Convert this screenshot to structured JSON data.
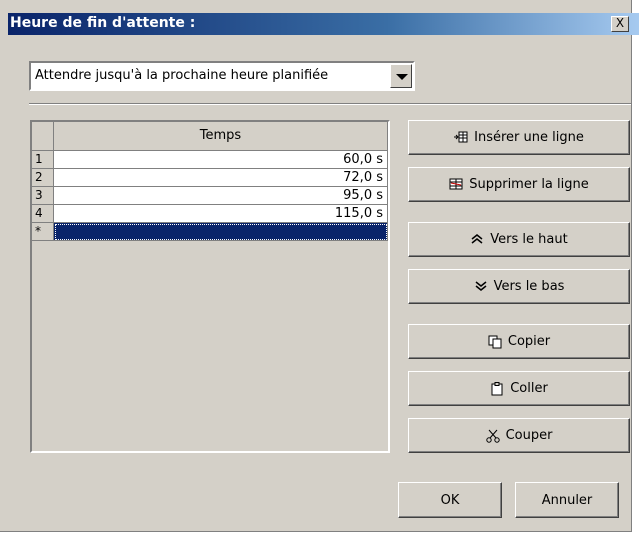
{
  "window": {
    "title": "Heure de fin d'attente :",
    "close_glyph": "X"
  },
  "combo": {
    "value": "Attendre jusqu'à la prochaine heure planifiée"
  },
  "table": {
    "header": "Temps",
    "rows": [
      {
        "index": "1",
        "value": "60,0 s"
      },
      {
        "index": "2",
        "value": "72,0 s"
      },
      {
        "index": "3",
        "value": "95,0 s"
      },
      {
        "index": "4",
        "value": "115,0 s"
      }
    ],
    "new_row_marker": "*"
  },
  "buttons": {
    "insert": {
      "label": "Insérer une ligne",
      "icon": "insert-row-icon"
    },
    "delete": {
      "label": "Supprimer la ligne",
      "icon": "delete-row-icon"
    },
    "up": {
      "label": "Vers le haut",
      "icon": "double-chevron-up-icon"
    },
    "down": {
      "label": "Vers le bas",
      "icon": "double-chevron-down-icon"
    },
    "copy": {
      "label": "Copier",
      "icon": "copy-icon"
    },
    "paste": {
      "label": "Coller",
      "icon": "paste-icon"
    },
    "cut": {
      "label": "Couper",
      "icon": "scissors-icon"
    },
    "ok": "OK",
    "cancel": "Annuler"
  },
  "colors": {
    "title_start": "#0a246a",
    "title_end": "#a6caf0",
    "face": "#d4d0c8",
    "selection": "#0a246a"
  }
}
